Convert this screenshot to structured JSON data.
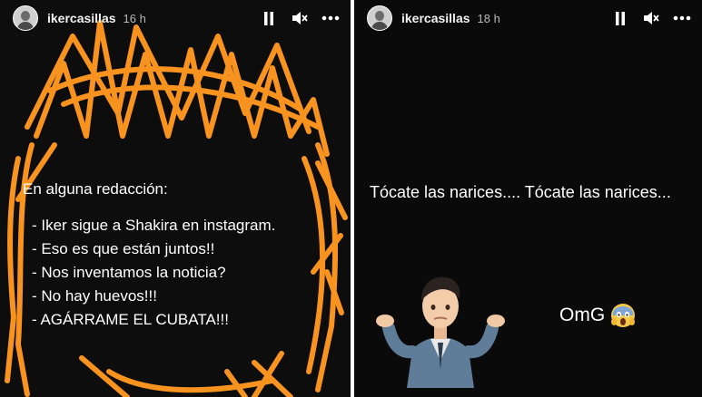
{
  "stories": [
    {
      "username": "ikercasillas",
      "time": "16 h",
      "heading": "En alguna redacción:",
      "lines": [
        "- Iker sigue a Shakira en instagram.",
        "- Eso es que están juntos!!",
        "- Nos inventamos la noticia?",
        "- No hay huevos!!!",
        "- AGÁRRAME EL CUBATA!!!"
      ],
      "scribble_color": "#f7931e"
    },
    {
      "username": "ikercasillas",
      "time": "18 h",
      "text": "Tócate las narices.... Tócate las narices...",
      "caption": "OmG",
      "caption_emoji": "face-screaming-in-fear-icon"
    }
  ],
  "controls": [
    "pause-icon",
    "mute-icon",
    "more-options-icon"
  ]
}
